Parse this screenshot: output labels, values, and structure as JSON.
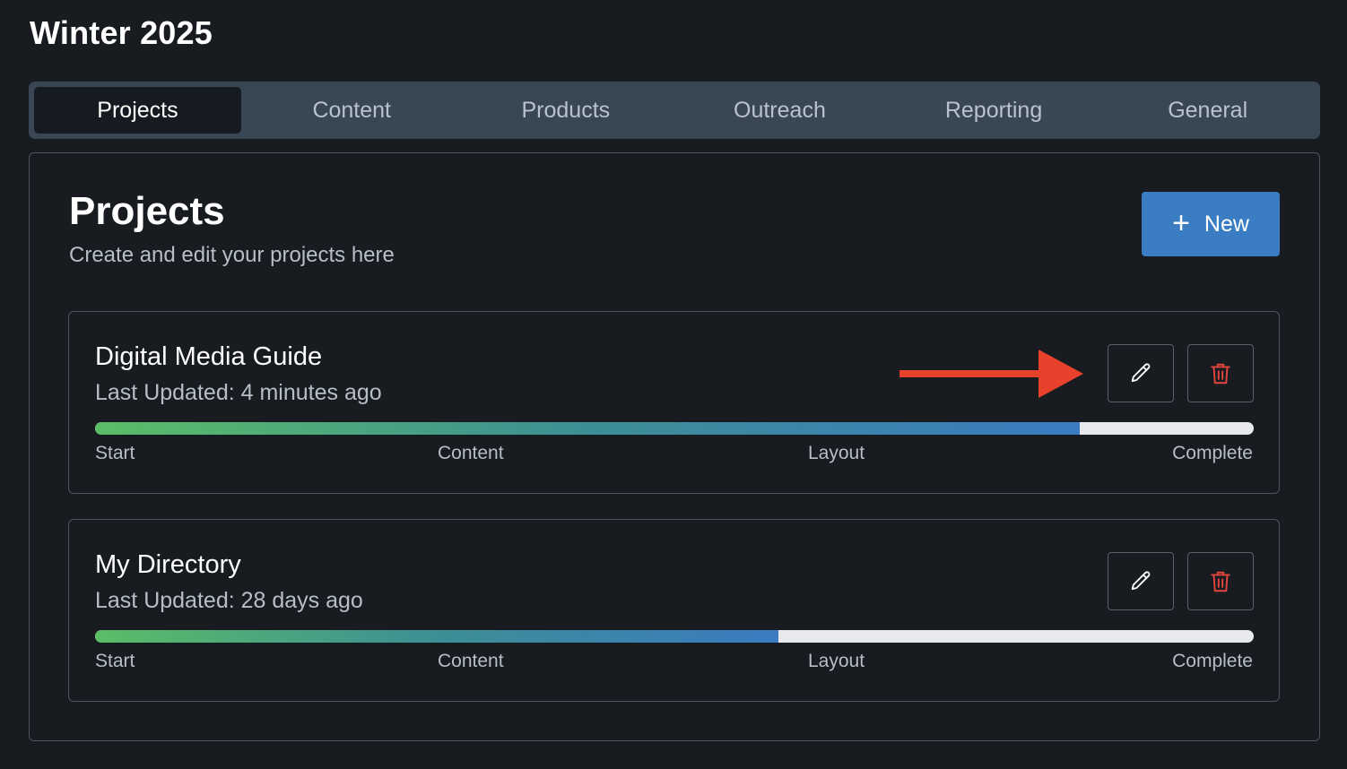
{
  "header": {
    "title": "Winter 2025"
  },
  "tabs": [
    {
      "label": "Projects",
      "active": true
    },
    {
      "label": "Content",
      "active": false
    },
    {
      "label": "Products",
      "active": false
    },
    {
      "label": "Outreach",
      "active": false
    },
    {
      "label": "Reporting",
      "active": false
    },
    {
      "label": "General",
      "active": false
    }
  ],
  "panel": {
    "title": "Projects",
    "subtitle": "Create and edit your projects here",
    "new_button": {
      "icon": "plus-icon",
      "label": "New"
    }
  },
  "projects": [
    {
      "name": "Digital Media Guide",
      "last_updated": "Last Updated: 4 minutes ago",
      "progress": 0.85,
      "stages": [
        "Start",
        "Content",
        "Layout",
        "Complete"
      ],
      "edit_icon": "pencil-icon",
      "delete_icon": "trash-icon"
    },
    {
      "name": "My Directory",
      "last_updated": "Last Updated: 28 days ago",
      "progress": 0.59,
      "stages": [
        "Start",
        "Content",
        "Layout",
        "Complete"
      ],
      "edit_icon": "pencil-icon",
      "delete_icon": "trash-icon"
    }
  ],
  "annotation": {
    "icon": "arrow-right-icon",
    "color": "#e8412c"
  },
  "colors": {
    "background": "#181c21",
    "tab_bar": "#394653",
    "accent": "#3b7dc2",
    "delete": "#e0463d",
    "progress_start": "#5bbd66",
    "progress_end": "#3a7bc1"
  }
}
